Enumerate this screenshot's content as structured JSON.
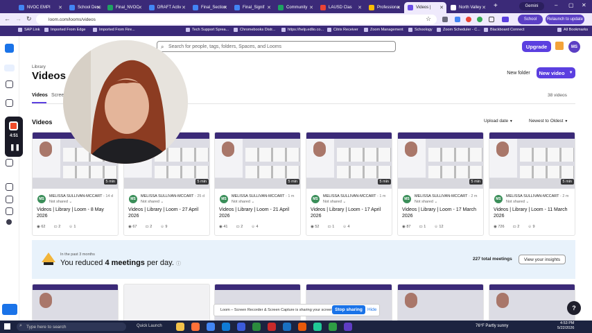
{
  "browser": {
    "tabs": [
      {
        "label": "NVOC EMPI",
        "color": "#4285f4"
      },
      {
        "label": "School Desc",
        "color": "#4285f4"
      },
      {
        "label": "Final_NVOC",
        "color": "#1ea362"
      },
      {
        "label": "DRAFT Activ",
        "color": "#4285f4"
      },
      {
        "label": "Final_Section",
        "color": "#4285f4"
      },
      {
        "label": "Final_Signif",
        "color": "#4285f4"
      },
      {
        "label": "Community",
        "color": "#1ea362"
      },
      {
        "label": "LAUSD Clas",
        "color": "#ea4335"
      },
      {
        "label": "Professiona",
        "color": "#fbbc05"
      },
      {
        "label": "Videos |",
        "color": "#6b4de6"
      },
      {
        "label": "North Valley",
        "color": "#ffffff"
      }
    ],
    "gemini_label": "Gemini",
    "url": "loom.com/looms/videos",
    "profile_label": "School",
    "relaunch_label": "Relaunch to update",
    "bookmarks": [
      "SAP Link",
      "Imported From Edge",
      "Imported From Fire...",
      "Tech Support Sprea...",
      "Chromebooks Distr...",
      "https://help.edlio.co...",
      "Citrix Receiver",
      "Zoom Management",
      "Schoology",
      "Zoom Scheduler - C...",
      "Blackboard Connect"
    ],
    "all_bookmarks_label": "All Bookmarks"
  },
  "recorder": {
    "time": "4:51"
  },
  "header": {
    "search_placeholder": "Search for people, tags, folders, Spaces, and Looms",
    "upgrade_label": "Upgrade",
    "avatar_initials": "MS"
  },
  "page": {
    "breadcrumb": "Library",
    "title": "Videos",
    "new_folder_label": "New folder",
    "new_video_label": "New video",
    "tabs": [
      "Videos",
      "Screen"
    ],
    "video_count": "38 videos",
    "section_title": "Videos",
    "upload_date_label": "Upload date",
    "sort_label": "Newest to Oldest"
  },
  "videos": [
    {
      "duration": "5 min",
      "author": "MELISSA SULLIVAN-MCCART",
      "ago": "14 d",
      "shared": "Not shared",
      "title": "Videos | Library | Loom - 8 May",
      "date": "2026",
      "views": "62",
      "comments": "2",
      "reactions": "1"
    },
    {
      "duration": "5 min",
      "author": "MELISSA SULLIVAN-MCCART",
      "ago": "25 d",
      "shared": "Not shared",
      "title": "Videos | Library | Loom - 27 April",
      "date": "2026",
      "views": "67",
      "comments": "2",
      "reactions": "9"
    },
    {
      "duration": "5 min",
      "author": "MELISSA SULLIVAN-MCCART",
      "ago": "1 m",
      "shared": "Not shared",
      "title": "Videos | Library | Loom - 21 April",
      "date": "2026",
      "views": "41",
      "comments": "2",
      "reactions": "4"
    },
    {
      "duration": "5 min",
      "author": "MELISSA SULLIVAN-MCCART",
      "ago": "1 m",
      "shared": "Not shared",
      "title": "Videos | Library | Loom - 17 April",
      "date": "2026",
      "views": "52",
      "comments": "1",
      "reactions": "4"
    },
    {
      "duration": "5 min",
      "author": "MELISSA SULLIVAN-MCCART",
      "ago": "2 m",
      "shared": "Not shared",
      "title": "Videos | Library | Loom - 17 March",
      "date": "2026",
      "views": "87",
      "comments": "1",
      "reactions": "12"
    },
    {
      "duration": "5 min",
      "author": "MELISSA SULLIVAN-MCCART",
      "ago": "2 m",
      "shared": "Not shared",
      "title": "Videos | Library | Loom - 11 March",
      "date": "2026",
      "views": "726",
      "comments": "2",
      "reactions": "9"
    }
  ],
  "insights": {
    "period": "In the past 3 months",
    "message_prefix": "You reduced ",
    "message_bold": "4 meetings",
    "message_suffix": " per day.",
    "total_meetings": "227 total meetings",
    "button_label": "View your insights"
  },
  "share_banner": {
    "text": "Loom – Screen Recorder & Screen Capture is sharing your screen.",
    "stop_label": "Stop sharing",
    "hide_label": "Hide"
  },
  "taskbar": {
    "search_placeholder": "Type here to search",
    "quick_launch": "Quick Launch",
    "weather": "76°F Partly sunny",
    "time": "4:53 PM",
    "date": "5/22/2026"
  },
  "colors": {
    "accent": "#5b3fe0",
    "browser_frame": "#3b2a78",
    "insights_bg": "#e8f2fb"
  }
}
